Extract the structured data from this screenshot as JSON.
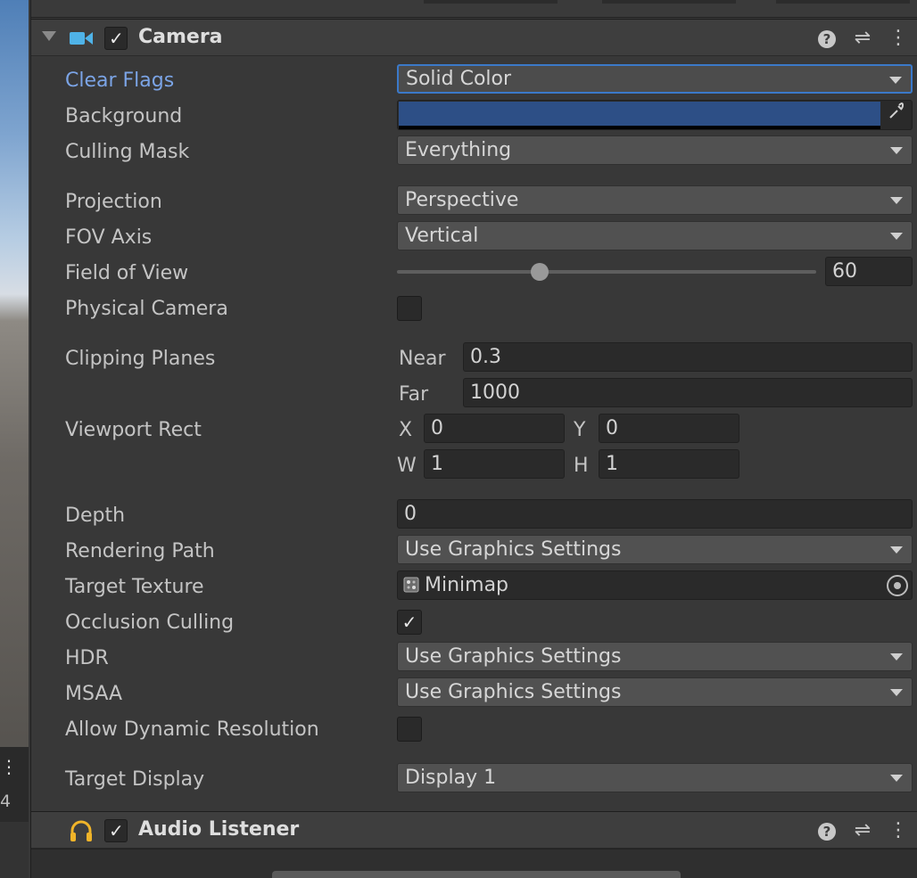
{
  "scene_strip": {
    "dots": "⋮",
    "number": "4"
  },
  "camera": {
    "title": "Camera",
    "enabled_mark": "✓",
    "fields": {
      "clear_flags": {
        "label": "Clear Flags",
        "value": "Solid Color"
      },
      "background": {
        "label": "Background",
        "color": "#2d4f86"
      },
      "culling_mask": {
        "label": "Culling Mask",
        "value": "Everything"
      },
      "projection": {
        "label": "Projection",
        "value": "Perspective"
      },
      "fov_axis": {
        "label": "FOV Axis",
        "value": "Vertical"
      },
      "field_of_view": {
        "label": "Field of View",
        "value": "60",
        "slider_fraction": 0.34
      },
      "physical_camera": {
        "label": "Physical Camera"
      },
      "clipping_planes": {
        "label": "Clipping Planes",
        "near_label": "Near",
        "near": "0.3",
        "far_label": "Far",
        "far": "1000"
      },
      "viewport_rect": {
        "label": "Viewport Rect",
        "x_label": "X",
        "x": "0",
        "y_label": "Y",
        "y": "0",
        "w_label": "W",
        "w": "1",
        "h_label": "H",
        "h": "1"
      },
      "depth": {
        "label": "Depth",
        "value": "0"
      },
      "rendering_path": {
        "label": "Rendering Path",
        "value": "Use Graphics Settings"
      },
      "target_texture": {
        "label": "Target Texture",
        "value": "Minimap"
      },
      "occlusion_culling": {
        "label": "Occlusion Culling",
        "check": "✓"
      },
      "hdr": {
        "label": "HDR",
        "value": "Use Graphics Settings"
      },
      "msaa": {
        "label": "MSAA",
        "value": "Use Graphics Settings"
      },
      "allow_dynamic_resolution": {
        "label": "Allow Dynamic Resolution"
      },
      "target_display": {
        "label": "Target Display",
        "value": "Display 1"
      }
    }
  },
  "audio_listener": {
    "title": "Audio Listener",
    "enabled_mark": "✓"
  },
  "header_buttons": {
    "help": "?",
    "preset": "⇌",
    "more": "⋮"
  },
  "colors": {
    "accent_label": "#7ba4e6",
    "focus_border": "#3b79c9",
    "panel": "#383838"
  }
}
